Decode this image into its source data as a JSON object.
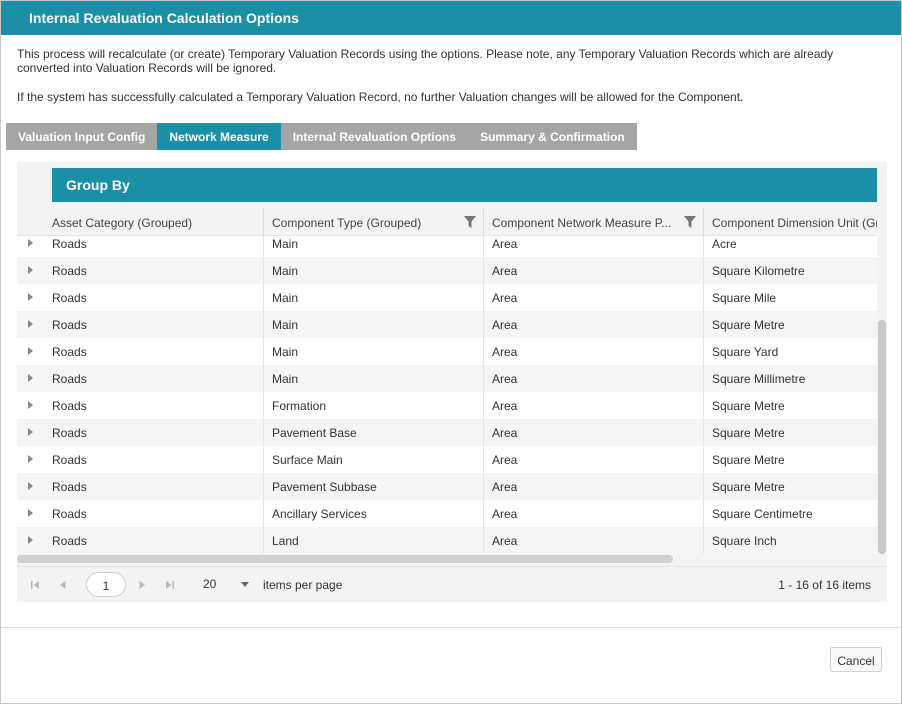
{
  "dialog": {
    "title": "Internal Revaluation Calculation Options",
    "intro_text": "This process will recalculate (or create) Temporary Valuation Records using the options. Please note, any Temporary Valuation Records which are already converted into Valuation Records will be ignored.",
    "intro_text_2": "If the system has successfully calculated a Temporary Valuation Record, no further Valuation changes will be allowed for the Component."
  },
  "tabs": [
    {
      "label": "Valuation Input Config",
      "active": false
    },
    {
      "label": "Network Measure",
      "active": true
    },
    {
      "label": "Internal Revaluation Options",
      "active": false
    },
    {
      "label": "Summary & Confirmation",
      "active": false
    }
  ],
  "grid": {
    "group_by_label": "Group By",
    "columns": [
      {
        "label": "Asset Category (Grouped)",
        "filter_icon": false
      },
      {
        "label": "Component Type (Grouped)",
        "filter_icon": true
      },
      {
        "label": "Component Network Measure P...",
        "filter_icon": true
      },
      {
        "label": "Component Dimension Unit (Gr",
        "filter_icon": false
      }
    ],
    "rows": [
      [
        "Roads",
        "Main",
        "Area",
        "Acre"
      ],
      [
        "Roads",
        "Main",
        "Area",
        "Square Kilometre"
      ],
      [
        "Roads",
        "Main",
        "Area",
        "Square Mile"
      ],
      [
        "Roads",
        "Main",
        "Area",
        "Square Metre"
      ],
      [
        "Roads",
        "Main",
        "Area",
        "Square Yard"
      ],
      [
        "Roads",
        "Main",
        "Area",
        "Square Millimetre"
      ],
      [
        "Roads",
        "Formation",
        "Area",
        "Square Metre"
      ],
      [
        "Roads",
        "Pavement Base",
        "Area",
        "Square Metre"
      ],
      [
        "Roads",
        "Surface Main",
        "Area",
        "Square Metre"
      ],
      [
        "Roads",
        "Pavement Subbase",
        "Area",
        "Square Metre"
      ],
      [
        "Roads",
        "Ancillary Services",
        "Area",
        "Square Centimetre"
      ],
      [
        "Roads",
        "Land",
        "Area",
        "Square Inch"
      ]
    ]
  },
  "pager": {
    "current_page": "1",
    "page_size": "20",
    "items_per_page_label": "items per page",
    "info": "1 - 16 of 16 items",
    "first_icon": "first-page-icon",
    "prev_icon": "prev-page-icon",
    "next_icon": "next-page-icon",
    "last_icon": "last-page-icon"
  },
  "footer": {
    "cancel_label": "Cancel"
  },
  "colors": {
    "accent": "#1a8fa5",
    "tab_inactive": "#a5a5a5"
  }
}
